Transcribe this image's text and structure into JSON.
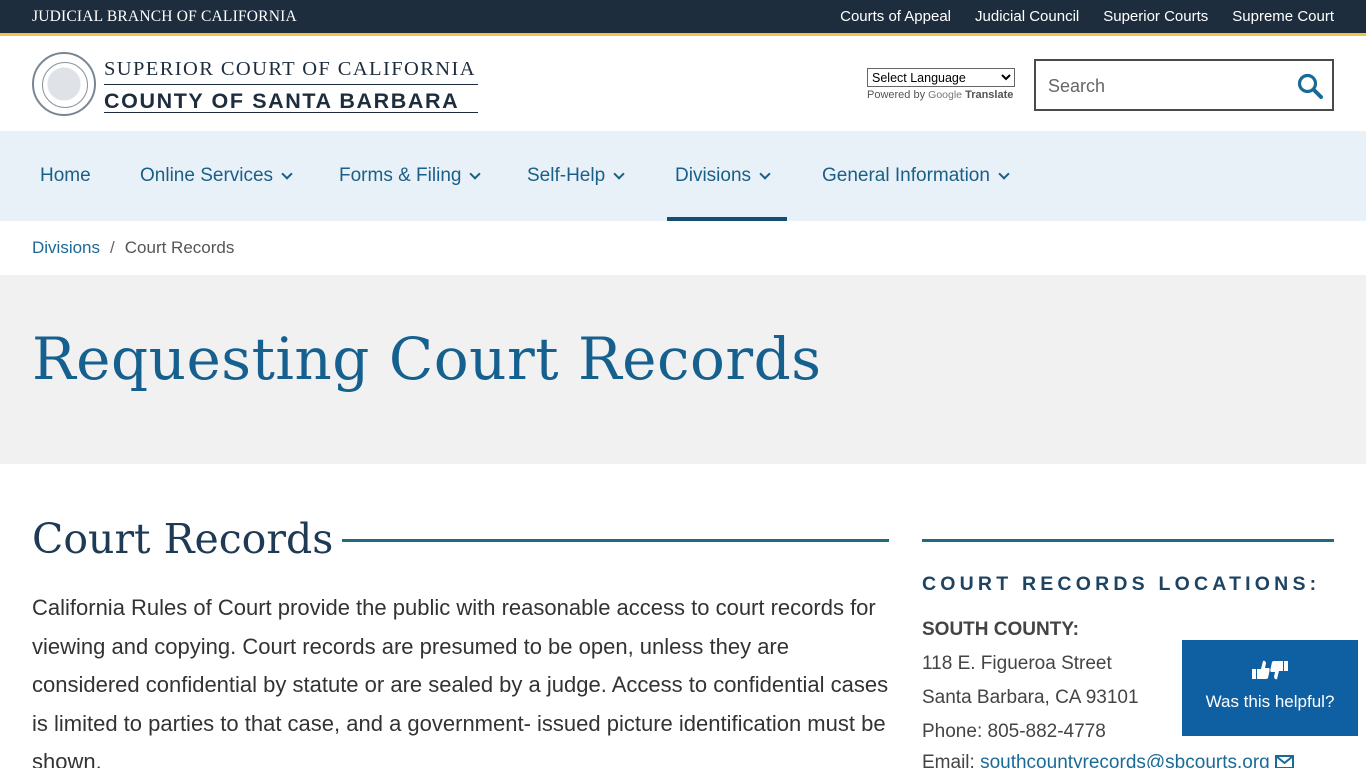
{
  "topbar": {
    "brand": "JUDICIAL BRANCH OF CALIFORNIA",
    "links": [
      "Courts of Appeal",
      "Judicial Council",
      "Superior Courts",
      "Supreme Court"
    ]
  },
  "header": {
    "logo_line1": "SUPERIOR COURT OF CALIFORNIA",
    "logo_line2": "COUNTY OF SANTA BARBARA",
    "translate_select": "Select Language",
    "powered_by": "Powered by",
    "google": "Google",
    "translate": "Translate",
    "search_placeholder": "Search"
  },
  "nav": {
    "items": [
      "Home",
      "Online Services",
      "Forms & Filing",
      "Self-Help",
      "Divisions",
      "General Information"
    ],
    "active": "Divisions"
  },
  "breadcrumb": {
    "parent": "Divisions",
    "separator": "/",
    "current": "Court Records"
  },
  "hero": {
    "title": "Requesting Court Records"
  },
  "main": {
    "section_title": "Court Records",
    "body": "California Rules of Court provide the public with reasonable access to court records for viewing and copying. Court records are presumed to be open, unless they are considered confidential by statute or are sealed by a judge. Access to confidential cases is limited to parties to that case, and a government- issued picture identification must be shown."
  },
  "sidebar": {
    "title": "COURT RECORDS LOCATIONS:",
    "south_county_heading": "SOUTH COUNTY:",
    "address1": "118 E. Figueroa Street",
    "address2": "Santa Barbara, CA 93101",
    "phone": "Phone: 805-882-4778",
    "email_label": "Email:",
    "email": "southcountyrecords@sbcourts.org"
  },
  "helpful": {
    "label": "Was this helpful?"
  },
  "colors": {
    "topbar_bg": "#1e2d3d",
    "accent_gold": "#f2c14e",
    "link_blue": "#1a5f87",
    "nav_bg": "#e9f1f8",
    "helpful_bg": "#0f5fa3"
  }
}
